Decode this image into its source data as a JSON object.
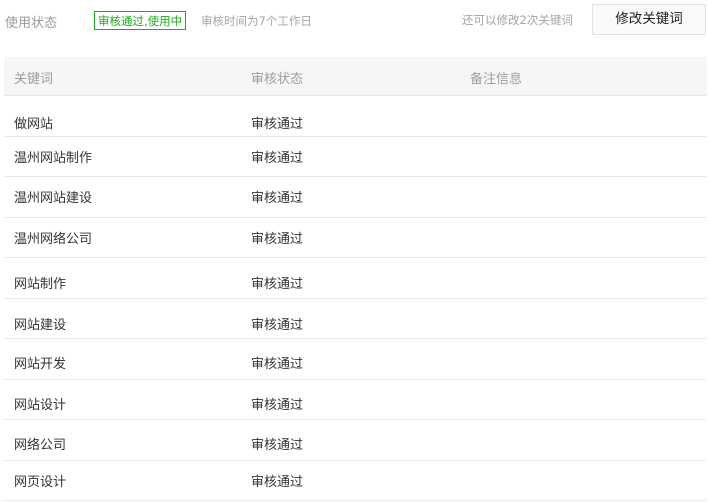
{
  "header": {
    "usage_label": "使用状态",
    "status_badge": "审核通过,使用中",
    "review_time": "审核时间为7个工作日",
    "remaining": "还可以修改2次关键词",
    "modify_button": "修改关键词"
  },
  "colors": {
    "status_green": "#1aad19",
    "header_bg": "#f5f6f7",
    "divider": "#e8e8e8"
  },
  "table": {
    "columns": [
      "关键词",
      "审核状态",
      "备注信息"
    ],
    "rows": [
      {
        "keyword": "做网站",
        "status": "审核通过",
        "note": ""
      },
      {
        "keyword": "温州网站制作",
        "status": "审核通过",
        "note": ""
      },
      {
        "keyword": "温州网站建设",
        "status": "审核通过",
        "note": ""
      },
      {
        "keyword": "温州网络公司",
        "status": "审核通过",
        "note": ""
      },
      {
        "keyword": "网站制作",
        "status": "审核通过",
        "note": ""
      },
      {
        "keyword": "网站建设",
        "status": "审核通过",
        "note": ""
      },
      {
        "keyword": "网站开发",
        "status": "审核通过",
        "note": ""
      },
      {
        "keyword": "网站设计",
        "status": "审核通过",
        "note": ""
      },
      {
        "keyword": "网络公司",
        "status": "审核通过",
        "note": ""
      },
      {
        "keyword": "网页设计",
        "status": "审核通过",
        "note": ""
      }
    ]
  }
}
